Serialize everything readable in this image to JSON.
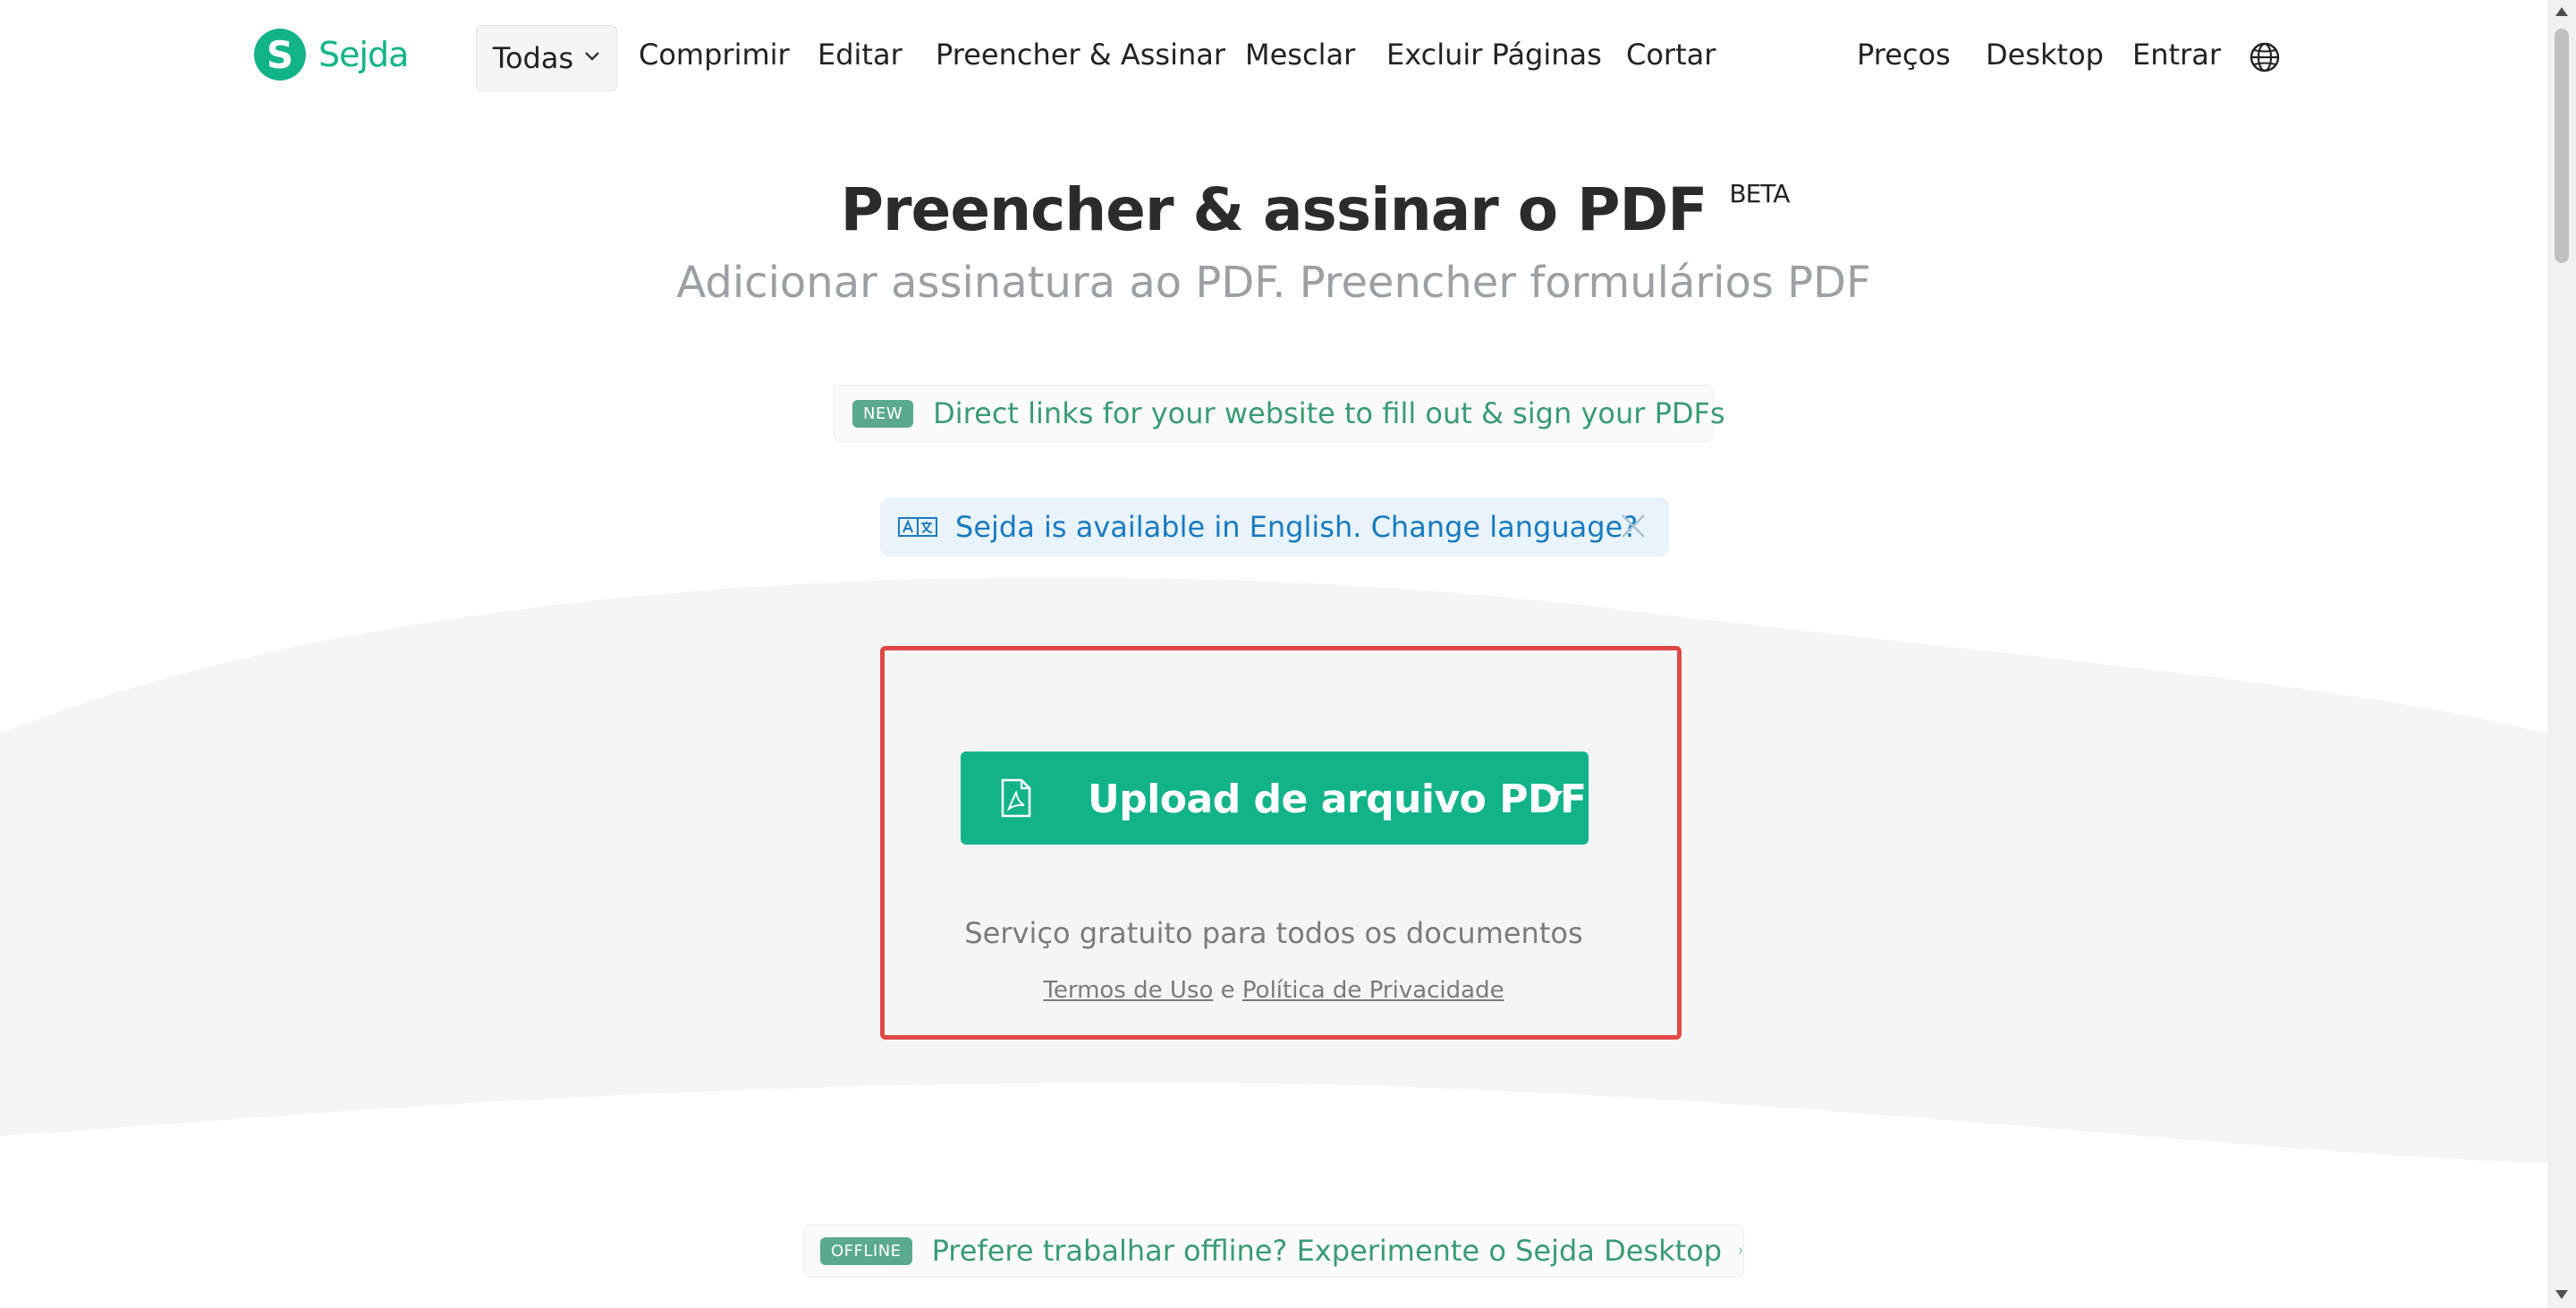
{
  "brand": {
    "logo_letter": "S",
    "name": "Sejda",
    "color": "#13b38a"
  },
  "nav": {
    "todas_label": "Todas",
    "links": [
      "Comprimir",
      "Editar",
      "Preencher & Assinar",
      "Mesclar",
      "Excluir Páginas",
      "Cortar"
    ],
    "right_links": [
      "Preços",
      "Desktop",
      "Entrar"
    ],
    "language_icon": "globe-icon"
  },
  "hero": {
    "title": "Preencher & assinar o PDF",
    "beta": "BETA",
    "subtitle": "Adicionar assinatura ao PDF. Preencher formulários PDF"
  },
  "new_banner": {
    "badge": "NEW",
    "text": "Direct links for your website to fill out & sign your PDFs",
    "chevron": "›"
  },
  "language_banner": {
    "icon": "translate-icon",
    "text": "Sejda is available in English. Change language?",
    "close_icon": "close-icon"
  },
  "upload": {
    "button_label": "Upload de arquivo PDF",
    "icon": "pdf-file-icon",
    "free_text": "Serviço gratuito para todos os documentos",
    "terms_link": "Termos de Uso",
    "conjunction": "e",
    "privacy_link": "Política de Privacidade",
    "highlight_color": "#e04848"
  },
  "offline_banner": {
    "badge": "OFFLINE",
    "text": "Prefere trabalhar offline? Experimente o Sejda Desktop",
    "chevron": "›"
  }
}
